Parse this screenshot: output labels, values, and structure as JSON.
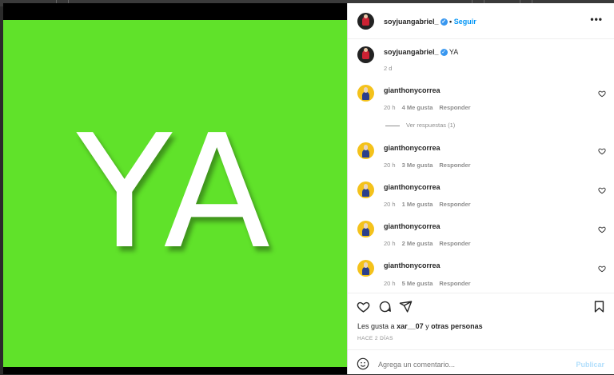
{
  "post": {
    "image_text": "YA"
  },
  "header": {
    "username": "soyjuangabriel_",
    "dot": "•",
    "follow_label": "Seguir",
    "more_label": "•••"
  },
  "caption": {
    "username": "soyjuangabriel_",
    "text": "YA",
    "time": "2 d"
  },
  "comments": [
    {
      "username": "gianthonycorrea",
      "time": "20 h",
      "likes": "4 Me gusta",
      "reply": "Responder"
    },
    {
      "username": "gianthonycorrea",
      "time": "20 h",
      "likes": "3 Me gusta",
      "reply": "Responder"
    },
    {
      "username": "gianthonycorrea",
      "time": "20 h",
      "likes": "1 Me gusta",
      "reply": "Responder"
    },
    {
      "username": "gianthonycorrea",
      "time": "20 h",
      "likes": "2 Me gusta",
      "reply": "Responder"
    },
    {
      "username": "gianthonycorrea",
      "time": "20 h",
      "likes": "5 Me gusta",
      "reply": "Responder"
    }
  ],
  "view_replies": "Ver respuestas (1)",
  "likes_line": {
    "prefix": "Les gusta a",
    "user": "xar__07",
    "connector": "y",
    "others": "otras personas"
  },
  "posted_ago": "HACE 2 DÍAS",
  "comment_box": {
    "placeholder": "Agrega un comentario...",
    "publish_label": "Publicar"
  },
  "colors": {
    "image_bg": "#60e22a",
    "accent": "#0095f6",
    "publish_disabled": "#b2dffc"
  },
  "icons": [
    "heart-icon",
    "comment-icon",
    "share-icon",
    "bookmark-icon",
    "emoji-icon",
    "verified-icon",
    "more-options-icon"
  ]
}
